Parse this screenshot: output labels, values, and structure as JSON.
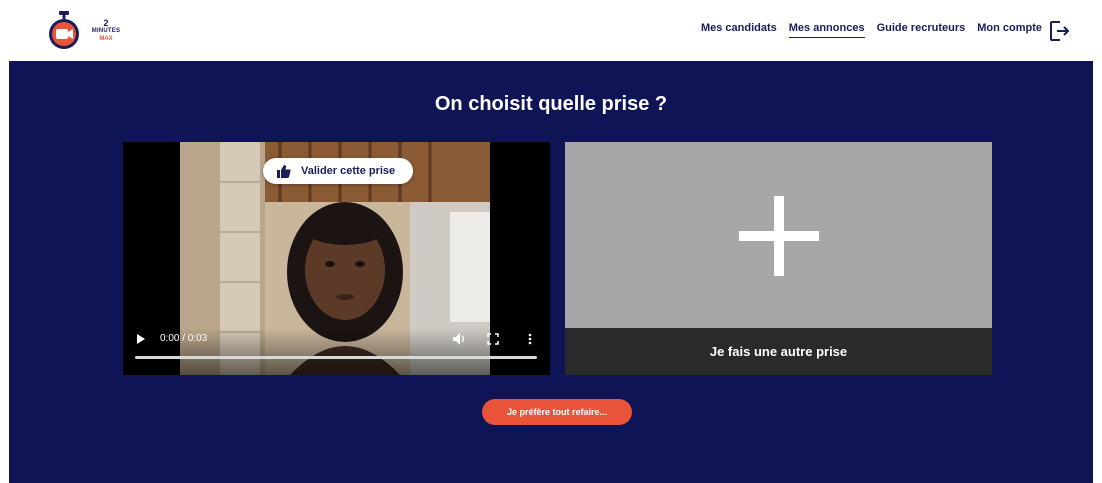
{
  "header": {
    "logo": {
      "number": "2",
      "word": "MINUTES",
      "max": "MAX"
    },
    "nav": [
      {
        "label": "Mes candidats",
        "active": false
      },
      {
        "label": "Mes annonces",
        "active": true
      },
      {
        "label": "Guide recruteurs",
        "active": false
      },
      {
        "label": "Mon compte",
        "active": false
      }
    ],
    "logout_icon": "logout-icon"
  },
  "main": {
    "title": "On choisit quelle prise ?",
    "video": {
      "validate_label": "Valider cette prise",
      "time": "0:00 / 0:03",
      "progress": 0
    },
    "new_take": {
      "label": "Je fais une autre prise",
      "icon": "plus-icon"
    },
    "redo_label": "Je préfère tout refaire..."
  },
  "colors": {
    "navy": "#0f1456",
    "accent": "#e8533a",
    "panel_grey": "#a7a7a7",
    "footer_dark": "#2a2a2a"
  }
}
